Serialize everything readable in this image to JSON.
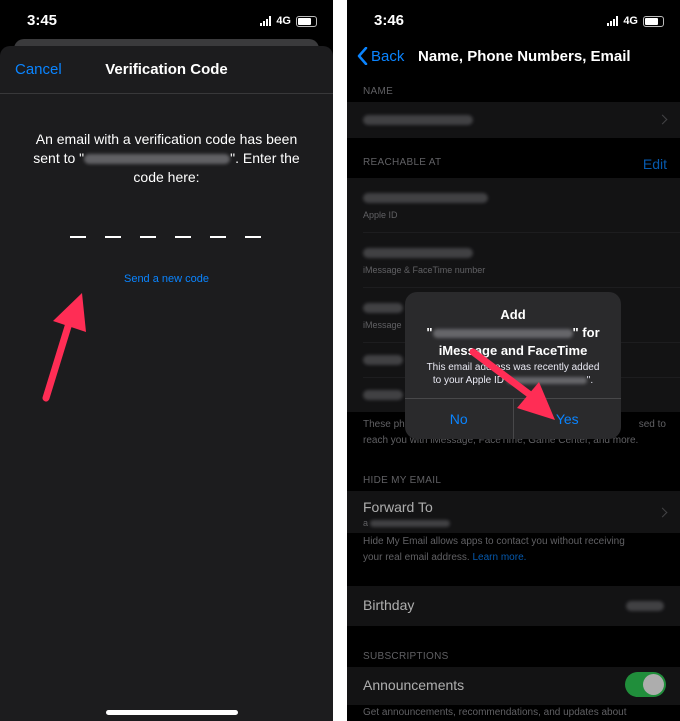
{
  "left": {
    "status": {
      "time": "3:45",
      "network": "4G"
    },
    "header": {
      "cancel": "Cancel",
      "title": "Verification Code"
    },
    "instructions": {
      "line1": "An email with a verification code has been",
      "line2_pre": "sent to \"",
      "line2_post": "\". Enter the",
      "line3": "code here:"
    },
    "resend": "Send a new code",
    "colors": {
      "accent": "#0a84ff",
      "arrow": "#ff2d55"
    }
  },
  "right": {
    "status": {
      "time": "3:46",
      "network": "4G"
    },
    "nav": {
      "back": "Back",
      "title": "Name, Phone Numbers, Email"
    },
    "sections": {
      "name": "NAME",
      "reachable": "REACHABLE AT",
      "edit": "Edit",
      "hide_email": "HIDE MY EMAIL",
      "subscriptions": "SUBSCRIPTIONS"
    },
    "reachable_items": [
      {
        "sub": "Apple ID"
      },
      {
        "sub": "iMessage & FaceTime number"
      },
      {
        "sub": "iMessage"
      }
    ],
    "reachable_footer": "These ph... sed to reach you with iMessage, FaceTime, Game Center, and more.",
    "reachable_footer_left": "These ph",
    "reachable_footer_right": "sed to",
    "reachable_footer_line2": "reach you with iMessage, FaceTime, Game Center, and more.",
    "forward": {
      "label": "Forward To",
      "sub_prefix": "a"
    },
    "hide_footer_line1": "Hide My Email allows apps to contact you without receiving",
    "hide_footer_line2": "your real email address.",
    "hide_footer_link": "Learn more.",
    "birthday": "Birthday",
    "announcements": "Announcements",
    "announcements_footer": "Get announcements, recommendations, and updates about",
    "alert": {
      "title_line1": "Add",
      "title_pre": "\"",
      "title_post": "\" for",
      "title_line3": "iMessage and FaceTime",
      "message_line1": "This email address was recently added",
      "message_line2_pre": "to your Apple ID",
      "message_line2_post": "\".",
      "no": "No",
      "yes": "Yes"
    },
    "toggle_on": true
  }
}
